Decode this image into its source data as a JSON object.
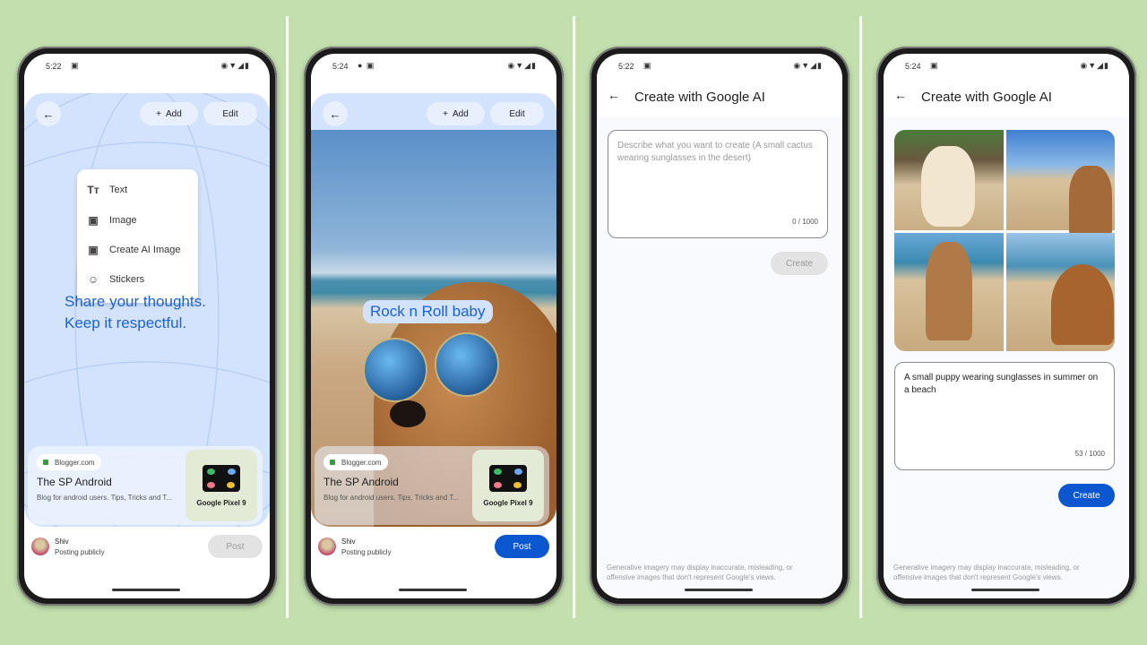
{
  "colors": {
    "background": "#c3dfae",
    "canvas": "#d3e3fd",
    "accent": "#0b57d0",
    "share_text": "#1a62d6"
  },
  "screens": [
    {
      "time": "5:22",
      "status_icons": [
        "image-icon"
      ],
      "right_icons": [
        "eye-icon",
        "wifi-icon",
        "signal-icon",
        "battery-icon"
      ],
      "back_icon": "arrow-back-icon",
      "add_label": "Add",
      "edit_label": "Edit",
      "menu": [
        {
          "icon": "text-format-icon",
          "glyph": "Tт",
          "label": "Text"
        },
        {
          "icon": "image-icon",
          "glyph": "▣",
          "label": "Image"
        },
        {
          "icon": "ai-image-icon",
          "glyph": "▣",
          "label": "Create AI Image"
        },
        {
          "icon": "sticker-icon",
          "glyph": "☺",
          "label": "Stickers"
        }
      ],
      "share_line1": "Share your thoughts.",
      "share_line2": "Keep it respectful.",
      "link": {
        "source": "Blogger.com",
        "title": "The SP Android",
        "desc": "Blog for android users. Tips, Tricks and T...",
        "thumb_label": "Google Pixel 9"
      },
      "user": {
        "name": "Shiv",
        "visibility": "Posting publicly"
      },
      "post_label": "Post",
      "post_enabled": false
    },
    {
      "time": "5:24",
      "add_label": "Add",
      "edit_label": "Edit",
      "overlay_text": "Rock n Roll baby",
      "link": {
        "source": "Blogger.com",
        "title": "The SP Android",
        "desc": "Blog for android users. Tips, Tricks and T...",
        "thumb_label": "Google Pixel 9"
      },
      "user": {
        "name": "Shiv",
        "visibility": "Posting publicly"
      },
      "post_label": "Post",
      "post_enabled": true
    },
    {
      "time": "5:22",
      "title": "Create with Google AI",
      "placeholder": "Describe what you want to create (A small cactus wearing sunglasses in the desert)",
      "counter": "0 / 1000",
      "create_label": "Create",
      "create_enabled": false,
      "disclaimer": "Generative imagery may display inaccurate, misleading, or offensive images that don't represent Google's views."
    },
    {
      "time": "5:24",
      "title": "Create with Google AI",
      "prompt": "A small puppy wearing sunglasses in summer on a beach",
      "counter": "53 / 1000",
      "create_label": "Create",
      "create_enabled": true,
      "disclaimer": "Generative imagery may display inaccurate, misleading, or offensive images that don't represent Google's views."
    }
  ]
}
